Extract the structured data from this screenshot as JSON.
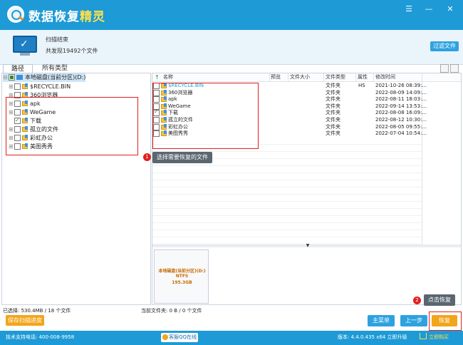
{
  "app": {
    "title_part1": "数据恢复",
    "title_part2": "精灵",
    "window_controls": [
      "☰",
      "—",
      "✕"
    ]
  },
  "header": {
    "status": "扫描结束",
    "count": "共发现19492个文件",
    "filter_button": "过滤文件"
  },
  "tabs": [
    "路径",
    "所有类型"
  ],
  "tree": {
    "root": "本地磁盘(当前分区)(D:)",
    "items": [
      {
        "label": "$RECYCLE.BIN",
        "check": "none"
      },
      {
        "label": "360浏览器",
        "check": "none"
      },
      {
        "label": "apk",
        "check": "none"
      },
      {
        "label": "WeGame",
        "check": "none"
      },
      {
        "label": "下载",
        "check": "checked"
      },
      {
        "label": "孤立的文件",
        "check": "none"
      },
      {
        "label": "彩虹办公",
        "check": "none"
      },
      {
        "label": "美图秀秀",
        "check": "none"
      }
    ]
  },
  "list": {
    "columns": [
      "名称",
      "预览",
      "文件大小",
      "文件类型",
      "属性",
      "修改时间"
    ],
    "rows": [
      {
        "name": "$RECYCLE.BIN",
        "type": "文件夹",
        "attr": "HS",
        "time": "2021-10-26 08:39:...",
        "check": "none",
        "color": "#2aa0c8"
      },
      {
        "name": "360浏览器",
        "type": "文件夹",
        "attr": "",
        "time": "2022-08-09 14:09:...",
        "check": "none",
        "color": "#222"
      },
      {
        "name": "apk",
        "type": "文件夹",
        "attr": "",
        "time": "2022-08-11 18:03:...",
        "check": "none",
        "color": "#222"
      },
      {
        "name": "WeGame",
        "type": "文件夹",
        "attr": "",
        "time": "2022-09-14 13:53:...",
        "check": "none",
        "color": "#222"
      },
      {
        "name": "下载",
        "type": "文件夹",
        "attr": "",
        "time": "2022-08-08 16:09:...",
        "check": "checked",
        "color": "#222"
      },
      {
        "name": "孤立的文件",
        "type": "文件夹",
        "attr": "",
        "time": "2022-08-12 10:30:...",
        "check": "none",
        "color": "#222"
      },
      {
        "name": "彩虹办公",
        "type": "文件夹",
        "attr": "",
        "time": "2022-08-05 09:55:...",
        "check": "none",
        "color": "#222"
      },
      {
        "name": "美图秀秀",
        "type": "文件夹",
        "attr": "",
        "time": "2022-07-04 10:54:...",
        "check": "none",
        "color": "#222"
      }
    ]
  },
  "preview": {
    "line1": "本地磁盘(当前分区)(D:)",
    "line2": "NTFS",
    "line3": "195.3GB"
  },
  "annotations": {
    "step1_num": "1",
    "step1_text": "选择需要恢复的文件",
    "step2_num": "2",
    "step2_text": "点击恢复"
  },
  "status": {
    "selected": "已选择: 530.4MB / 18 个文件",
    "current_folder": "当前文件夹: 0 B / 0 个文件"
  },
  "buttons": {
    "save_progress": "保存扫描进度",
    "main_menu": "主菜单",
    "previous": "上一步",
    "recover": "恢复"
  },
  "footer": {
    "support": "技术支持电话: 400-008-9958",
    "online": "客服QQ在线",
    "version": "版本: 4.4.0.435 x64  立即升级",
    "buy": "立即购买"
  },
  "colors": {
    "brand_blue": "#1e9ad6",
    "accent_orange": "#f2a51b",
    "button_blue": "#2ea2e0",
    "annotation_red": "#e02020"
  }
}
